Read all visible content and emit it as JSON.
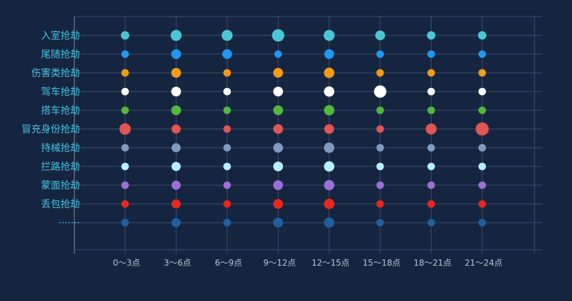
{
  "chart_data": {
    "type": "scatter",
    "title": "",
    "xlabel": "",
    "ylabel": "",
    "categories": [
      "0～3点",
      "3～6点",
      "6～9点",
      "9～12点",
      "12～15点",
      "15～18点",
      "18～21点",
      "21～24点"
    ],
    "series": [
      {
        "label": "入室抢劫",
        "color": "#4ac7d6",
        "values": [
          3,
          7,
          7,
          10,
          7,
          5,
          3,
          3
        ]
      },
      {
        "label": "尾随抢劫",
        "color": "#2196f3",
        "values": [
          2,
          5,
          5,
          2,
          5,
          2,
          2,
          2
        ]
      },
      {
        "label": "伤害类抢劫",
        "color": "#f39c12",
        "values": [
          2,
          5,
          2,
          5,
          6,
          2,
          2,
          2
        ]
      },
      {
        "label": "驾车抢劫",
        "color": "#ffffff",
        "values": [
          2,
          5,
          2,
          5,
          6,
          10,
          2,
          2
        ]
      },
      {
        "label": "搭车抢劫",
        "color": "#52b83c",
        "values": [
          2,
          5,
          2,
          5,
          6,
          2,
          2,
          2
        ]
      },
      {
        "label": "冒充身份抢劫",
        "color": "#e05555",
        "values": [
          8,
          4,
          2,
          5,
          5,
          2,
          7,
          12
        ]
      },
      {
        "label": "持械抢劫",
        "color": "#7f9bbf",
        "values": [
          2,
          4,
          2,
          5,
          6,
          2,
          2,
          2
        ]
      },
      {
        "label": "拦路抢劫",
        "color": "#b5f0ff",
        "values": [
          2,
          4,
          2,
          5,
          6,
          2,
          2,
          2
        ]
      },
      {
        "label": "蒙面抢劫",
        "color": "#9c6fd6",
        "values": [
          2,
          4,
          2,
          5,
          6,
          2,
          2,
          2
        ]
      },
      {
        "label": "丢包抢劫",
        "color": "#e8271e",
        "values": [
          2,
          4,
          2,
          5,
          6,
          2,
          2,
          2
        ]
      },
      {
        "label": "·······",
        "color": "#1f5fa0",
        "values": [
          2,
          4,
          2,
          5,
          6,
          2,
          2,
          2
        ]
      }
    ],
    "grid": true,
    "legend": "none"
  },
  "colors": {
    "background": "#16253f",
    "grid": "#3b4d6b",
    "axis": "#5a6b85",
    "y_label": "#3fc6e6",
    "x_label": "#b8c4d6"
  }
}
